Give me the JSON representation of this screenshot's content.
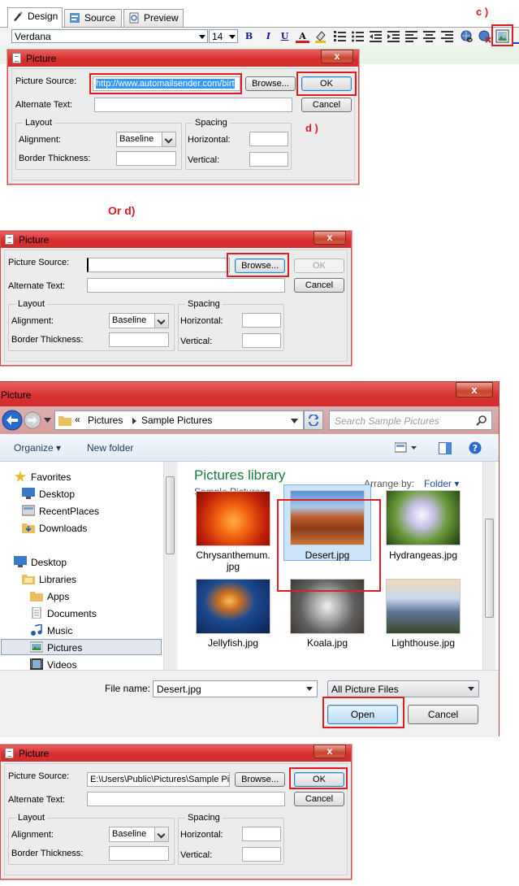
{
  "editor": {
    "tabs": [
      {
        "label": "Design"
      },
      {
        "label": "Source"
      },
      {
        "label": "Preview"
      }
    ],
    "font_name": "Verdana",
    "font_size": "14",
    "toolbar_glyphs": {
      "bold": "B",
      "italic": "I",
      "underline": "U",
      "font_color": "A"
    }
  },
  "annotations": {
    "c": "c )",
    "d": "d )",
    "or_d": "Or d)"
  },
  "dialogs": {
    "title": "Picture",
    "close_glyph": "x",
    "labels": {
      "source": "Picture Source:",
      "alt": "Alternate Text:",
      "layout": "Layout",
      "alignment": "Alignment:",
      "border": "Border Thickness:",
      "spacing": "Spacing",
      "horizontal": "Horizontal:",
      "vertical": "Vertical:",
      "browse": "Browse...",
      "ok": "OK",
      "cancel": "Cancel"
    },
    "alignment_value": "Baseline",
    "source_value_1": "http://www.automailsender.com/birt",
    "source_value_2": "",
    "source_value_4": "E:\\Users\\Public\\Pictures\\Sample Pi"
  },
  "file_dialog": {
    "title": "Picture",
    "breadcrumb_prefix": "«",
    "breadcrumb": [
      "Pictures",
      "Sample Pictures"
    ],
    "search_placeholder": "Search Sample Pictures",
    "organize": "Organize",
    "new_folder": "New folder",
    "nav": {
      "favorites": "Favorites",
      "desktop": "Desktop",
      "recent": "RecentPlaces",
      "downloads": "Downloads",
      "desktop2": "Desktop",
      "libraries": "Libraries",
      "apps": "Apps",
      "documents": "Documents",
      "music": "Music",
      "pictures": "Pictures",
      "videos": "Videos"
    },
    "library_title": "Pictures library",
    "library_subtitle": "Sample Pictures",
    "arrange_label": "Arrange by:",
    "arrange_value": "Folder",
    "files": [
      {
        "name": "Chrysanthemum.\njpg"
      },
      {
        "name": "Desert.jpg"
      },
      {
        "name": "Hydrangeas.jpg"
      },
      {
        "name": "Jellyfish.jpg"
      },
      {
        "name": "Koala.jpg"
      },
      {
        "name": "Lighthouse.jpg"
      }
    ],
    "file_name_label": "File name:",
    "file_name_value": "Desert.jpg",
    "filter_value": "All Picture Files",
    "open": "Open",
    "cancel": "Cancel"
  },
  "colors": {
    "annotation_red": "#e01c24",
    "title_red": "#d83030",
    "selection_blue": "#3399ff",
    "library_green": "#1e7a3e",
    "link_blue": "#1e4e9a"
  }
}
